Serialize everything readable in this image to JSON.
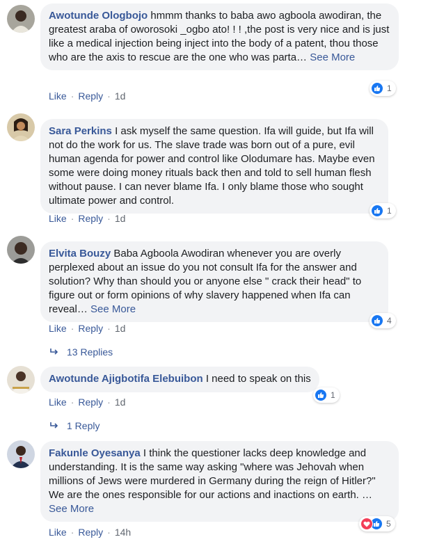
{
  "comments": [
    {
      "author": "Awotunde Ologbojo",
      "text": " hmmm thanks to baba awo agboola awodiran, the greatest araba of oworosoki _ogbo ato! ! ! ,the post is very nice and is just like a medical injection being inject into the body of a patent, thou those who are the axis to rescue are the one who was parta…",
      "see_more": "See More",
      "like": "Like",
      "reply": "Reply",
      "time": "1d",
      "reaction_count": "1"
    },
    {
      "author": "Sara Perkins",
      "text": " I ask myself the same question. Ifa will guide, but Ifa will not do the work for us. The slave trade was born out of a pure, evil human agenda for power and control like Olodumare has. Maybe even some were doing money rituals back then and told to sell human flesh without pause. I can never blame Ifa. I only blame those who sought ultimate power and control.",
      "like": "Like",
      "reply": "Reply",
      "time": "1d",
      "reaction_count": "1"
    },
    {
      "author": "Elvita Bouzy",
      "text": " Baba Agboola Awodiran whenever you are overly perplexed about an issue do you not consult Ifa for the answer and solution? Why than should you or anyone else \" crack their head\" to figure out or form opinions of why slavery happened when Ifa can reveal…",
      "see_more": "See More",
      "like": "Like",
      "reply": "Reply",
      "time": "1d",
      "reaction_count": "4",
      "replies": "13 Replies"
    },
    {
      "author": "Awotunde Ajigbotifa Elebuibon",
      "text": " I need to speak on this",
      "like": "Like",
      "reply": "Reply",
      "time": "1d",
      "reaction_count": "1",
      "replies": "1 Reply"
    },
    {
      "author": "Fakunle Oyesanya",
      "text": " I think the questioner lacks deep knowledge and understanding. It is the same way asking \"where was Jehovah when millions of Jews were murdered in Germany during the reign of Hitler?\" We are the ones responsible for our actions and inactions on earth. …",
      "see_more": "See More",
      "like": "Like",
      "reply": "Reply",
      "time": "14h",
      "reaction_count": "5"
    }
  ],
  "colors": {
    "link": "#385898",
    "bubble": "#f2f3f5",
    "like": "#1877f2",
    "love": "#f33e58"
  },
  "icons": {
    "like": "thumbs-up-icon",
    "love": "heart-icon",
    "reply_arrow": "reply-arrow-icon"
  }
}
